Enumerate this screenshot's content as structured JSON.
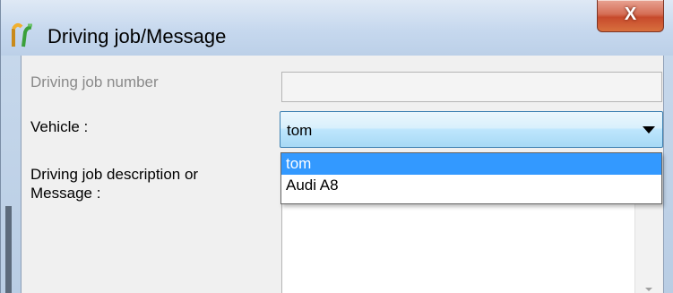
{
  "window": {
    "title": "Driving job/Message",
    "close_label": "X"
  },
  "form": {
    "job_number_label": "Driving job number",
    "job_number_value": "",
    "vehicle_label": "Vehicle :",
    "vehicle_selected": "tom",
    "description_label_line1": "Driving job description or",
    "description_label_line2": "Message :"
  },
  "vehicle_dropdown": {
    "options": [
      "tom",
      "Audi A8"
    ],
    "highlighted_index": 0
  },
  "icons": {
    "app": "driving-job-app-icon",
    "close": "close-icon",
    "combo_arrow": "chevron-down-icon"
  },
  "colors": {
    "selection": "#3399ff",
    "close_button": "#c74a2c",
    "titlebar": "#c6d8ee"
  }
}
